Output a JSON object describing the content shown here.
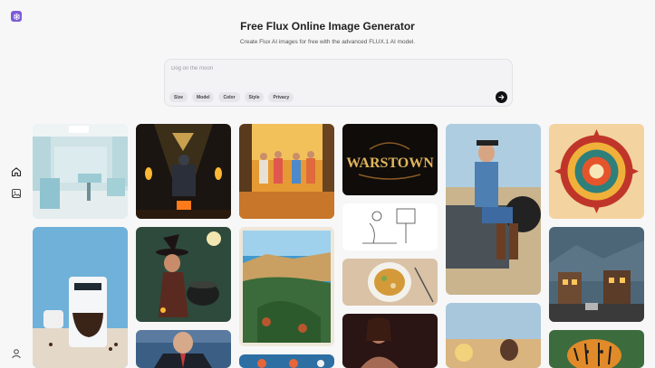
{
  "header": {
    "title": "Free Flux Online Image Generator",
    "subtitle": "Create Flux AI images for free with the advanced FLUX.1 AI model."
  },
  "prompt": {
    "placeholder": "Dog on the moon",
    "chips": [
      "Size",
      "Model",
      "Color",
      "Style",
      "Privacy"
    ]
  },
  "rail": {
    "items": [
      "home-icon",
      "gallery-icon",
      "user-icon"
    ]
  },
  "gallery": {
    "logo_text": "WARSTOWN"
  },
  "colors": {
    "accent": "#7c5cd6",
    "send": "#111111"
  }
}
